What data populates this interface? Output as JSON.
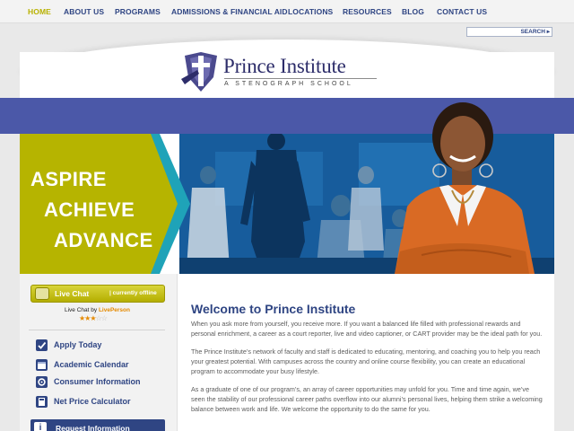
{
  "nav": {
    "items": [
      "HOME",
      "ABOUT US",
      "PROGRAMS",
      "ADMISSIONS & FINANCIAL AID",
      "LOCATIONS",
      "RESOURCES",
      "BLOG",
      "CONTACT US"
    ],
    "active": "HOME"
  },
  "search": {
    "button": "SEARCH ▸",
    "value": ""
  },
  "logo": {
    "name": "Prince Institute",
    "tagline": "A STENOGRAPH SCHOOL"
  },
  "hero": {
    "slogans": [
      "ASPIRE",
      "ACHIEVE",
      "ADVANCE"
    ]
  },
  "livechat": {
    "label": "Live Chat",
    "status": "|  currently offline",
    "by_prefix": "Live Chat by ",
    "by_brand": "LivePerson",
    "rating_stars": "★★★",
    "rating_empty": "☆☆",
    "rating": 3
  },
  "sidebar_links": [
    {
      "label": "Apply Today",
      "icon": "checkbox-icon"
    },
    {
      "label": "Academic Calendar",
      "icon": "calendar-icon"
    },
    {
      "label": "Consumer Information",
      "icon": "gear-icon"
    },
    {
      "label": "Net Price Calculator",
      "icon": "calculator-icon"
    }
  ],
  "request_button": {
    "label": "Request Information",
    "icon": "info-icon"
  },
  "main": {
    "title": "Welcome to Prince Institute",
    "paragraphs": [
      "When you ask more from yourself, you receive more. If you want a balanced life filled with professional rewards and personal enrichment, a career as a court reporter, live and video captioner, or CART provider may be the ideal path for you.",
      "The Prince Institute’s network of faculty and staff is dedicated to educating, mentoring, and coaching you to help you reach your greatest potential. With campuses across the country and online course flexibility, you can create an educational program to accommodate your busy lifestyle.",
      "As a graduate of one of our program’s, an array of career opportunities may unfold for you. Time and time again, we’ve seen the stability of our professional career paths overflow into our alumni’s personal lives, helping them strike a welcoming balance between work and life. We welcome the opportunity to do the same for you."
    ]
  },
  "colors": {
    "nav_text": "#2f4583",
    "nav_active": "#b8b100",
    "band": "#4b58a8",
    "slogan_panel": "#b6b400",
    "chat_bar": "#c4be10",
    "text": "#5c5c5c"
  }
}
